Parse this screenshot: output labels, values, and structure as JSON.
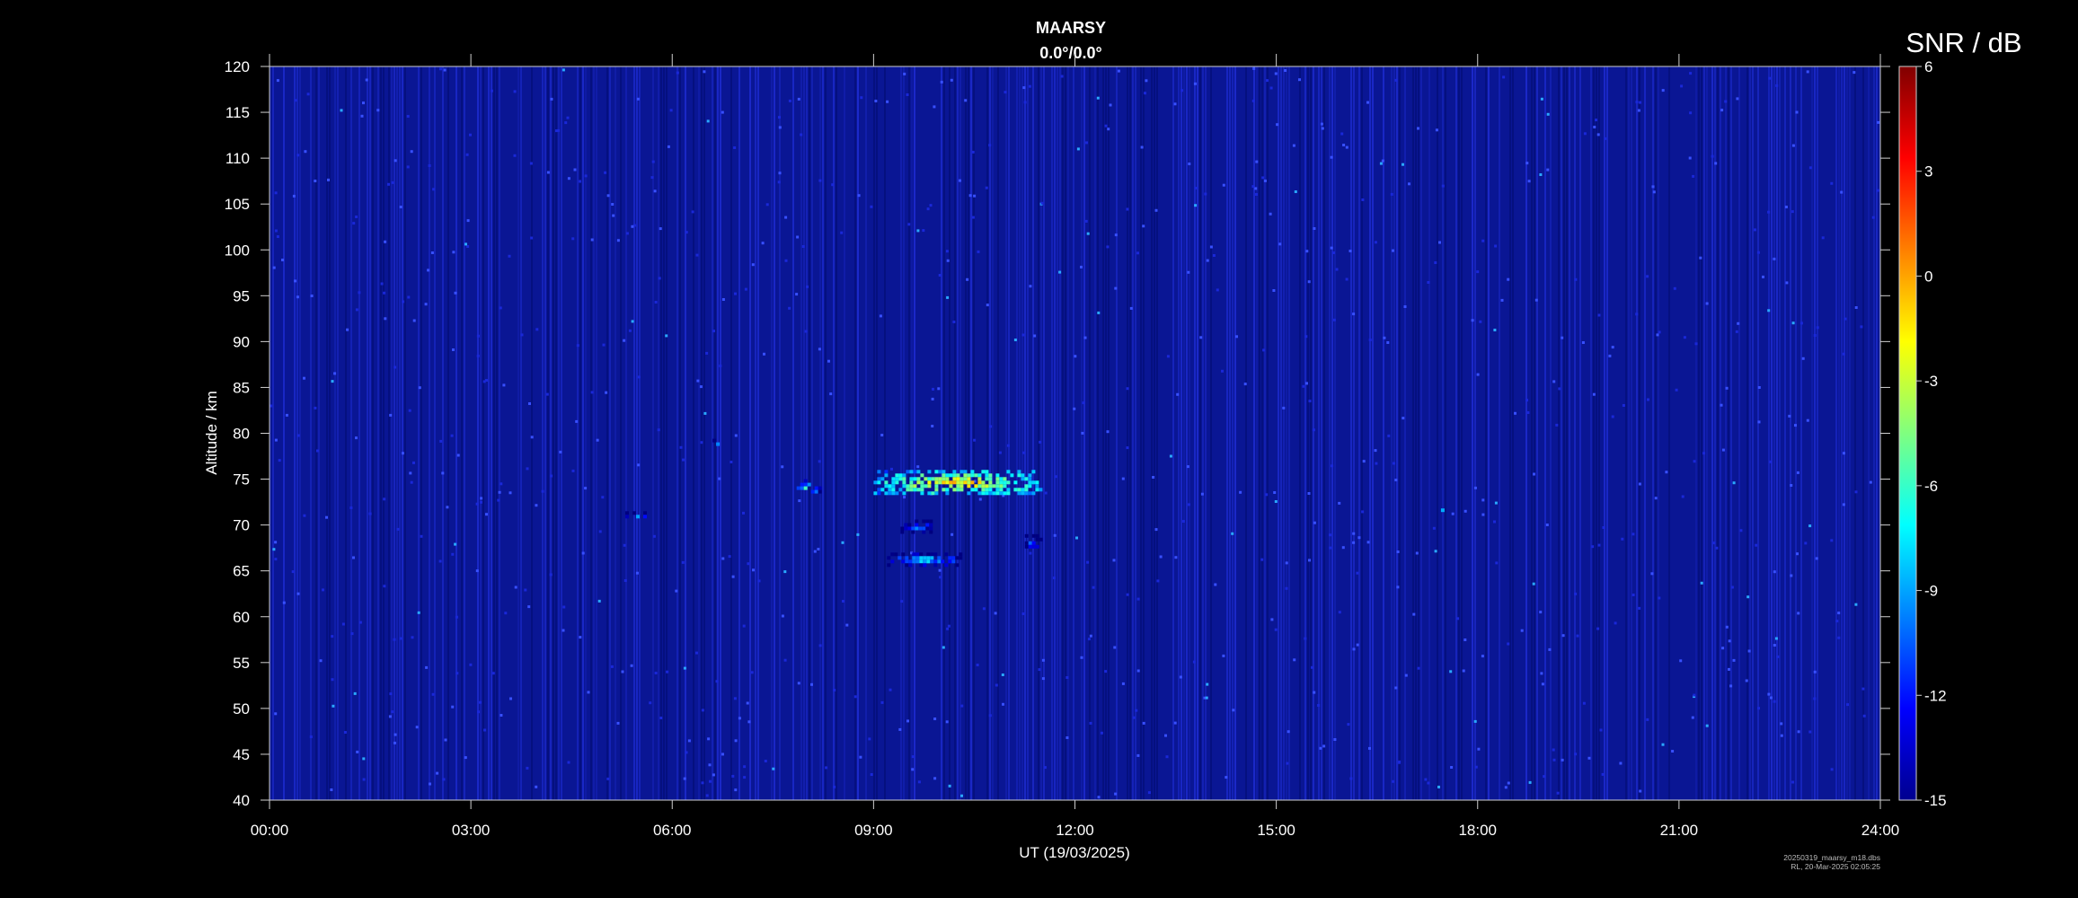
{
  "chart_data": {
    "type": "heatmap",
    "title": "MAARSY",
    "subtitle": "0.0°/0.0°",
    "xlabel": "UT (19/03/2025)",
    "ylabel": "Altitude / km",
    "x_ticks": [
      "00:00",
      "03:00",
      "06:00",
      "09:00",
      "12:00",
      "15:00",
      "18:00",
      "21:00",
      "24:00"
    ],
    "xlim_hours": [
      0,
      24
    ],
    "y_ticks": [
      40,
      45,
      50,
      55,
      60,
      65,
      70,
      75,
      80,
      85,
      90,
      95,
      100,
      105,
      110,
      115,
      120
    ],
    "ylim": [
      40,
      120
    ],
    "colorbar": {
      "label": "SNR / dB",
      "ticks": [
        6,
        3,
        0,
        -3,
        -6,
        -9,
        -12,
        -15
      ],
      "range": [
        -15,
        6
      ],
      "colormap": "jet"
    },
    "background_snr_db": -13.5,
    "echoes": [
      {
        "t_start": 9.0,
        "t_end": 11.5,
        "alt_bottom": 73.5,
        "alt_top": 76.0,
        "peak_snr_db": 1
      },
      {
        "t_start": 7.8,
        "t_end": 8.2,
        "alt_bottom": 73.5,
        "alt_top": 75.0,
        "peak_snr_db": -4
      },
      {
        "t_start": 5.3,
        "t_end": 5.6,
        "alt_bottom": 70.8,
        "alt_top": 71.5,
        "peak_snr_db": -6
      },
      {
        "t_start": 9.2,
        "t_end": 10.3,
        "alt_bottom": 65.8,
        "alt_top": 67.0,
        "peak_snr_db": -5
      },
      {
        "t_start": 9.4,
        "t_end": 9.9,
        "alt_bottom": 69.2,
        "alt_top": 70.6,
        "peak_snr_db": -7
      },
      {
        "t_start": 11.2,
        "t_end": 11.5,
        "alt_bottom": 67.5,
        "alt_top": 69.0,
        "peak_snr_db": -8
      },
      {
        "t_start": 6.6,
        "t_end": 6.7,
        "alt_bottom": 78.8,
        "alt_top": 79.4,
        "peak_snr_db": -6
      },
      {
        "t_start": 17.4,
        "t_end": 17.5,
        "alt_bottom": 71.6,
        "alt_top": 72.2,
        "peak_snr_db": -4
      }
    ]
  },
  "footer": {
    "file_line": "20250319_maarsy_m18.dbs",
    "credit_line": "RL, 20-Mar-2025 02:05:25"
  }
}
